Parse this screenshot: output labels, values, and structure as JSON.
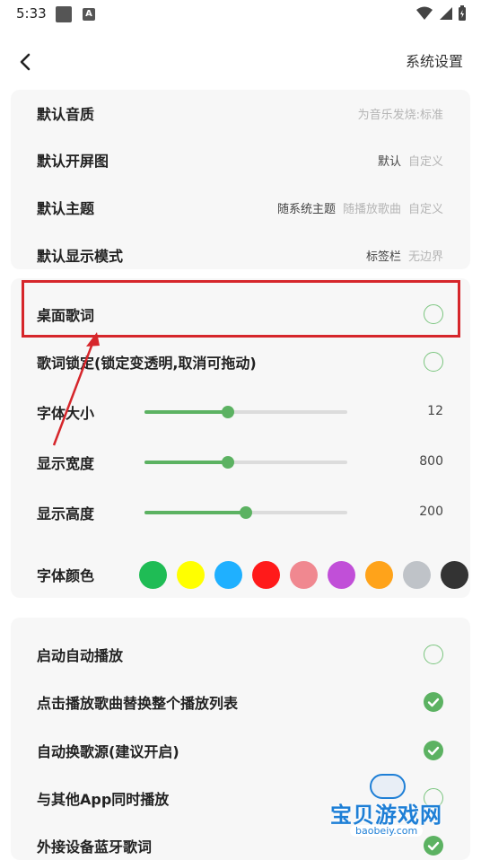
{
  "status_bar": {
    "time": "5:33",
    "a_icon": "A",
    "icons": [
      "photo-icon",
      "a-icon",
      "wifi-icon",
      "signal-icon",
      "battery-icon"
    ]
  },
  "header": {
    "back_icon": "chevron-left-icon",
    "title": "系统设置"
  },
  "defaults": {
    "quality": {
      "label": "默认音质",
      "value": "为音乐发烧:标准"
    },
    "splash": {
      "label": "默认开屏图",
      "options": [
        "默认",
        "自定义"
      ]
    },
    "theme": {
      "label": "默认主题",
      "options": [
        "随系统主题",
        "随播放歌曲",
        "自定义"
      ]
    },
    "display_mode": {
      "label": "默认显示模式",
      "options": [
        "标签栏",
        "无边界"
      ]
    }
  },
  "lyrics": {
    "desktop_lyrics": {
      "label": "桌面歌词",
      "checked": false
    },
    "lyrics_lock": {
      "label": "歌词锁定(锁定变透明,取消可拖动)",
      "checked": false
    },
    "font_size": {
      "label": "字体大小",
      "value": "12",
      "fraction": 0.41
    },
    "display_width": {
      "label": "显示宽度",
      "value": "800",
      "fraction": 0.41
    },
    "display_height": {
      "label": "显示高度",
      "value": "200",
      "fraction": 0.5
    },
    "font_color": {
      "label": "字体颜色",
      "colors": [
        "#1fbc55",
        "#ffff00",
        "#1fb0ff",
        "#ff1a1a",
        "#f08890",
        "#c14fd8",
        "#ffa31a",
        "#bfc3c8",
        "#333333"
      ]
    }
  },
  "playback": {
    "auto_play": {
      "label": "启动自动播放",
      "checked": false
    },
    "replace_list": {
      "label": "点击播放歌曲替换整个播放列表",
      "checked": true
    },
    "auto_switch_source": {
      "label": "自动换歌源(建议开启)",
      "checked": true
    },
    "play_with_other": {
      "label": "与其他App同时播放",
      "checked": false
    },
    "bt_lyrics": {
      "label": "外接设备蓝牙歌词",
      "checked": true
    }
  },
  "watermark": {
    "title": "宝贝游戏网",
    "url": "baobeiy.com"
  },
  "colors": {
    "accent": "#5cb262",
    "highlight": "#d6262b"
  }
}
